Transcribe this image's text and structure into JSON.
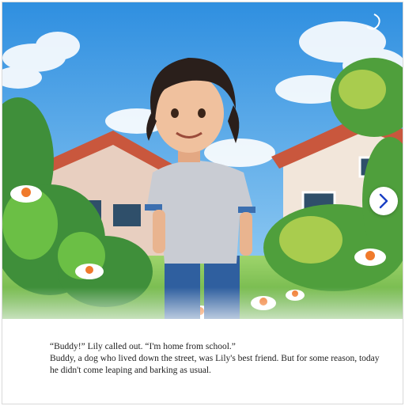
{
  "storybook": {
    "illustration": {
      "subject": "Boy standing in a sunny garden in front of houses"
    },
    "navigation": {
      "next_icon": "chevron-right-icon"
    },
    "text": {
      "line1": "“Buddy!” Lily called out. “I'm home from school.”",
      "line2": "Buddy, a dog who lived down the street, was Lily's best friend. But for some reason, today he didn't come leaping and barking as usual."
    },
    "colors": {
      "sky": "#3f9ee6",
      "accent": "#1a3fc4",
      "text": "#222222"
    }
  }
}
